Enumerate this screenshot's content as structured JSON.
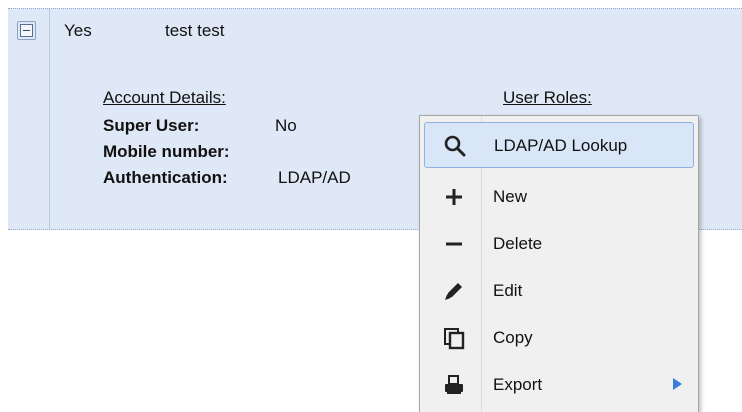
{
  "row": {
    "status": "Yes",
    "name": "test test"
  },
  "details": {
    "account_header": "Account Details:",
    "roles_header": "User Roles:",
    "super_user_label": "Super User:",
    "super_user_value": "No",
    "mobile_label": "Mobile number:",
    "mobile_value": "",
    "auth_label": "Authentication:",
    "auth_value": "LDAP/AD"
  },
  "context_menu": {
    "items": [
      {
        "label": "LDAP/AD Lookup",
        "icon": "search-icon"
      },
      {
        "label": "New",
        "icon": "plus-icon"
      },
      {
        "label": "Delete",
        "icon": "minus-icon"
      },
      {
        "label": "Edit",
        "icon": "pencil-icon"
      },
      {
        "label": "Copy",
        "icon": "copy-icon"
      },
      {
        "label": "Export",
        "icon": "printer-icon"
      }
    ]
  },
  "colors": {
    "row_background": "#dfe8f6",
    "menu_background": "#f0f0f0",
    "menu_highlight": "#d8e6f8",
    "submenu_arrow": "#3a7bd5"
  }
}
